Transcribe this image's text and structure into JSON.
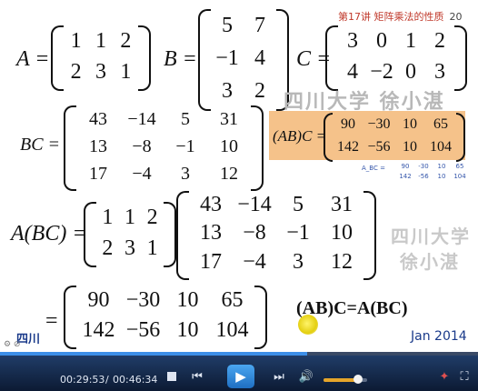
{
  "header": {
    "title": "第17讲 矩阵乘法的性质",
    "page": "20"
  },
  "watermarks": {
    "line1": "四川大学  徐小湛",
    "side1": "四川大学",
    "side2": "徐小湛",
    "corner": "四川"
  },
  "equation": {
    "A_label": "A =",
    "B_label": "B =",
    "C_label": "C =",
    "BC_label": "BC =",
    "ABC_label": "(AB)C =",
    "A_BC_label": "A(BC) =",
    "eq_label": "=",
    "tiny_label": "A_BC ="
  },
  "matrices": {
    "A": [
      [
        "1",
        "1",
        "2"
      ],
      [
        "2",
        "3",
        "1"
      ]
    ],
    "B": [
      [
        "5",
        "7"
      ],
      [
        "−1",
        "4"
      ],
      [
        "3",
        "2"
      ]
    ],
    "C": [
      [
        "3",
        "0",
        "1",
        "2"
      ],
      [
        "4",
        "−2",
        "0",
        "3"
      ]
    ],
    "BC": [
      [
        "43",
        "−14",
        "5",
        "31"
      ],
      [
        "13",
        "−8",
        "−1",
        "10"
      ],
      [
        "17",
        "−4",
        "3",
        "12"
      ]
    ],
    "AB_C": [
      [
        "90",
        "−30",
        "10",
        "65"
      ],
      [
        "142",
        "−56",
        "10",
        "104"
      ]
    ],
    "tiny": [
      [
        "90",
        "-30",
        "10",
        "65"
      ],
      [
        "142",
        "-56",
        "10",
        "104"
      ]
    ],
    "A2": [
      [
        "1",
        "1",
        "2"
      ],
      [
        "2",
        "3",
        "1"
      ]
    ],
    "BC2": [
      [
        "43",
        "−14",
        "5",
        "31"
      ],
      [
        "13",
        "−8",
        "−1",
        "10"
      ],
      [
        "17",
        "−4",
        "3",
        "12"
      ]
    ],
    "result": [
      [
        "90",
        "−30",
        "10",
        "65"
      ],
      [
        "142",
        "−56",
        "10",
        "104"
      ]
    ]
  },
  "conclusion": "(AB)C=A(BC)",
  "date": "Jan 2014",
  "player": {
    "time_current": "00:29:53",
    "time_sep": "/",
    "time_total": "00:46:34",
    "progress_fraction": 0.642,
    "volume_fraction": 0.8,
    "accent": "#3c8ee8"
  },
  "icons": {
    "stop": "stop-icon",
    "prev": "previous-icon",
    "play": "play-icon",
    "next": "next-icon",
    "volume": "volume-icon",
    "settings": "settings-icon",
    "fullscreen": "fullscreen-icon"
  }
}
